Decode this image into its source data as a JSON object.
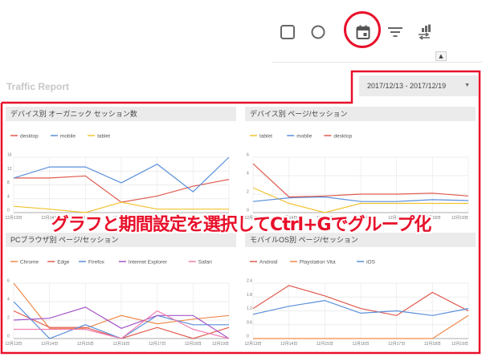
{
  "toolbar": {
    "tools": [
      {
        "id": "tool-square",
        "icon": "square-icon"
      },
      {
        "id": "tool-circle",
        "icon": "circle-icon"
      },
      {
        "id": "tool-calendar",
        "icon": "calendar-icon"
      },
      {
        "id": "tool-filter",
        "icon": "filter-icon"
      },
      {
        "id": "tool-sort",
        "icon": "sort-icon"
      }
    ],
    "highlight_color": "#e8102a",
    "scroll_arrow": "▲"
  },
  "report": {
    "title": "Traffic Report",
    "date_range": "2017/12/13 - 2017/12/19",
    "date_caret": "▼"
  },
  "caption": "グラフと期間設定を選択してCtrl+Gでグループ化",
  "chart_data": [
    {
      "type": "line",
      "title": "デバイス別 オーガニック セッション数",
      "categories": [
        "12月13日",
        "12月14日",
        "12月15日",
        "12月16日",
        "12月17日",
        "12月18日",
        "12月19日"
      ],
      "ylim": [
        0,
        16
      ],
      "yticks": [
        0,
        4,
        8,
        12,
        16
      ],
      "series": [
        {
          "name": "desktop",
          "color": "#e05a4e",
          "values": [
            10,
            10,
            10.6,
            3,
            4.8,
            7.6,
            9.6
          ]
        },
        {
          "name": "mobile",
          "color": "#5a8fdb",
          "values": [
            10,
            13.2,
            13.2,
            8.6,
            14,
            6,
            16
          ]
        },
        {
          "name": "tablet",
          "color": "#f2c230",
          "values": [
            1.8,
            1,
            0,
            3,
            1,
            1,
            1
          ]
        }
      ],
      "grid": true,
      "legend": "top-left"
    },
    {
      "type": "line",
      "title": "デバイス別 ページ/セッション",
      "categories": [
        "12月13日",
        "12月14日",
        "12月15日",
        "12月16日",
        "12月17日",
        "12月18日",
        "12月19日"
      ],
      "ylim": [
        0,
        6
      ],
      "yticks": [
        0,
        2,
        4,
        6
      ],
      "series": [
        {
          "name": "tablet",
          "color": "#f2c230",
          "values": [
            2.7,
            1,
            0,
            1,
            1,
            1,
            1
          ]
        },
        {
          "name": "mobile",
          "color": "#5a8fdb",
          "values": [
            1.2,
            1.6,
            1.7,
            1.2,
            1.2,
            1.4,
            1.3
          ]
        },
        {
          "name": "desktop",
          "color": "#e05a4e",
          "values": [
            5.3,
            1.7,
            1.8,
            2,
            2,
            2.1,
            1.8
          ]
        }
      ],
      "grid": true,
      "legend": "top-left"
    },
    {
      "type": "line",
      "title": "PCブラウザ別 ページ/セッション",
      "categories": [
        "12月13日",
        "12月14日",
        "12月15日",
        "12月16日",
        "12月17日",
        "12月18日",
        "12月19日"
      ],
      "ylim": [
        0,
        6
      ],
      "yticks": [
        0,
        2,
        4,
        6
      ],
      "series": [
        {
          "name": "Chrome",
          "color": "#f08a4b",
          "values": [
            6,
            1.1,
            1.1,
            2.5,
            1.6,
            2.1,
            2.5
          ]
        },
        {
          "name": "Edge",
          "color": "#e05a4e",
          "values": [
            3,
            1.2,
            1.2,
            0,
            1.2,
            0,
            1.2
          ]
        },
        {
          "name": "Firefox",
          "color": "#5a8fdb",
          "values": [
            4,
            0,
            1.5,
            0,
            2.5,
            1.5,
            1.5
          ]
        },
        {
          "name": "Internet Explorer",
          "color": "#a455c9",
          "values": [
            2,
            2.2,
            3.4,
            1.1,
            2.5,
            2.5,
            0
          ]
        },
        {
          "name": "Safari",
          "color": "#f07fb0",
          "values": [
            1,
            1,
            1,
            0,
            3,
            1,
            0
          ]
        }
      ],
      "grid": true,
      "legend": "top-left"
    },
    {
      "type": "line",
      "title": "モバイルOS別 ページ/セッション",
      "categories": [
        "12月13日",
        "12月14日",
        "12月15日",
        "12月16日",
        "12月17日",
        "12月18日",
        "12月19日"
      ],
      "ylim": [
        0,
        2.4
      ],
      "yticks": [
        0,
        0.6,
        1.2,
        1.8,
        2.4
      ],
      "series": [
        {
          "name": "Android",
          "color": "#e05a4e",
          "values": [
            1.3,
            2.3,
            1.85,
            1.3,
            1,
            2,
            1.2
          ]
        },
        {
          "name": "Playstation Vita",
          "color": "#f08a4b",
          "values": [
            0,
            0,
            0,
            0,
            0,
            0,
            1
          ]
        },
        {
          "name": "iOS",
          "color": "#5a8fdb",
          "values": [
            1.05,
            1.4,
            1.65,
            1.1,
            1.2,
            1,
            1.3
          ]
        }
      ],
      "grid": true,
      "legend": "top-left"
    }
  ]
}
